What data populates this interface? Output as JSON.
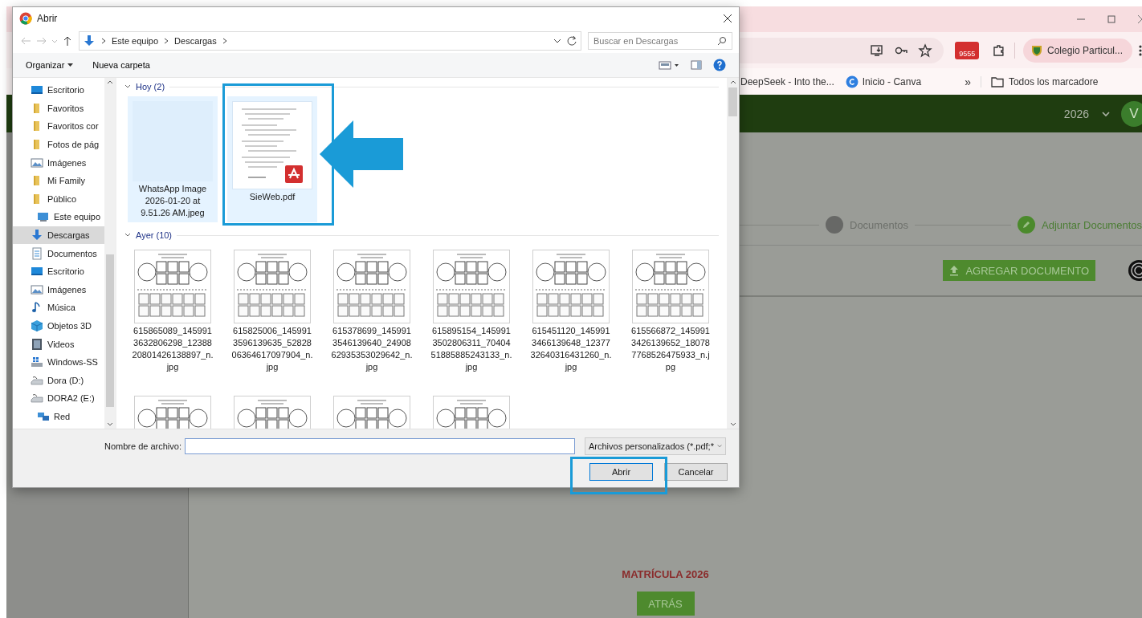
{
  "browser": {
    "toolbar": {
      "extension_badge": "9555",
      "profile_chip": "Colegio Particul..."
    },
    "bookmarks": [
      {
        "label": "DeepSeek - Into the...",
        "kind": "deepseek"
      },
      {
        "label": "Inicio - Canva",
        "kind": "canva"
      }
    ],
    "bookmarks_overflow": "»",
    "all_bookmarks": "Todos los marcadore",
    "header": {
      "year": "2026",
      "avatar": "V"
    },
    "stepper": [
      {
        "label": "Documentos",
        "done": false
      },
      {
        "label": "Adjuntar Documentos",
        "done": true
      }
    ],
    "add_button": "AGREGAR DOCUMENTO",
    "footer_title": "MATRÍCULA 2026",
    "back_button": "ATRÁS"
  },
  "dialog": {
    "title": "Abrir",
    "breadcrumb": [
      "Este equipo",
      "Descargas"
    ],
    "search": {
      "placeholder": "Buscar en Descargas"
    },
    "toolbar": {
      "organize": "Organizar",
      "new_folder": "Nueva carpeta"
    },
    "nav": {
      "upper_items": [
        {
          "label": "Escritorio",
          "kind": "desktop",
          "selected": false
        },
        {
          "label": "Favoritos",
          "kind": "folder",
          "selected": false
        },
        {
          "label": "Favoritos cor",
          "kind": "folder",
          "selected": false
        },
        {
          "label": "Fotos de pág",
          "kind": "folder",
          "selected": false
        },
        {
          "label": "Imágenes",
          "kind": "images",
          "selected": false
        },
        {
          "label": "Mi Family",
          "kind": "folder",
          "selected": false
        },
        {
          "label": "Público",
          "kind": "folder",
          "selected": false
        }
      ],
      "items": [
        {
          "label": "Este equipo",
          "kind": "pc",
          "selected": false,
          "children": [
            {
              "label": "Descargas",
              "kind": "download",
              "selected": true
            },
            {
              "label": "Documentos",
              "kind": "document",
              "selected": false
            },
            {
              "label": "Escritorio",
              "kind": "desktop",
              "selected": false
            },
            {
              "label": "Imágenes",
              "kind": "images",
              "selected": false
            },
            {
              "label": "Música",
              "kind": "music",
              "selected": false
            },
            {
              "label": "Objetos 3D",
              "kind": "cube",
              "selected": false
            },
            {
              "label": "Videos",
              "kind": "video",
              "selected": false
            },
            {
              "label": "Windows-SS",
              "kind": "system-drive",
              "selected": false
            },
            {
              "label": "Dora (D:)",
              "kind": "drive",
              "selected": false
            },
            {
              "label": "DORA2 (E:)",
              "kind": "drive",
              "selected": false
            }
          ]
        },
        {
          "label": "Red",
          "kind": "network",
          "selected": false
        }
      ]
    },
    "groups": [
      {
        "label": "Hoy (2)",
        "expanded": true,
        "files": [
          {
            "name": "WhatsApp Image\n2026-01-20 at\n9.51.26 AM.jpeg",
            "kind": "photo",
            "selected": true
          },
          {
            "name": "SieWeb.pdf",
            "kind": "pdf",
            "selected": true
          }
        ]
      },
      {
        "label": "Ayer (10)",
        "expanded": true,
        "files": [
          {
            "name": "615865089_145991\n3632806298_12388\n20801426138897_n.\njpg",
            "kind": "worksheet",
            "selected": false
          },
          {
            "name": "615825006_145991\n3596139635_52828\n06364617097904_n.\njpg",
            "kind": "worksheet",
            "selected": false
          },
          {
            "name": "615378699_145991\n3546139640_24908\n62935353029642_n.\njpg",
            "kind": "worksheet",
            "selected": false
          },
          {
            "name": "615895154_145991\n3502806311_70404\n51885885243133_n.\njpg",
            "kind": "worksheet",
            "selected": false
          },
          {
            "name": "615451120_145991\n3466139648_12377\n32640316431260_n.\njpg",
            "kind": "worksheet",
            "selected": false
          },
          {
            "name": "615566872_145991\n3426139652_18078\n7768526475933_n.j\npg",
            "kind": "worksheet",
            "selected": false
          },
          {
            "kind": "worksheet",
            "selected": false
          },
          {
            "kind": "worksheet",
            "selected": false
          },
          {
            "kind": "worksheet",
            "selected": false
          },
          {
            "kind": "worksheet",
            "selected": false
          }
        ]
      }
    ],
    "filename_label": "Nombre de archivo:",
    "filetype": "Archivos personalizados (*.pdf;*",
    "buttons": [
      "Abrir",
      "Cancelar"
    ]
  }
}
